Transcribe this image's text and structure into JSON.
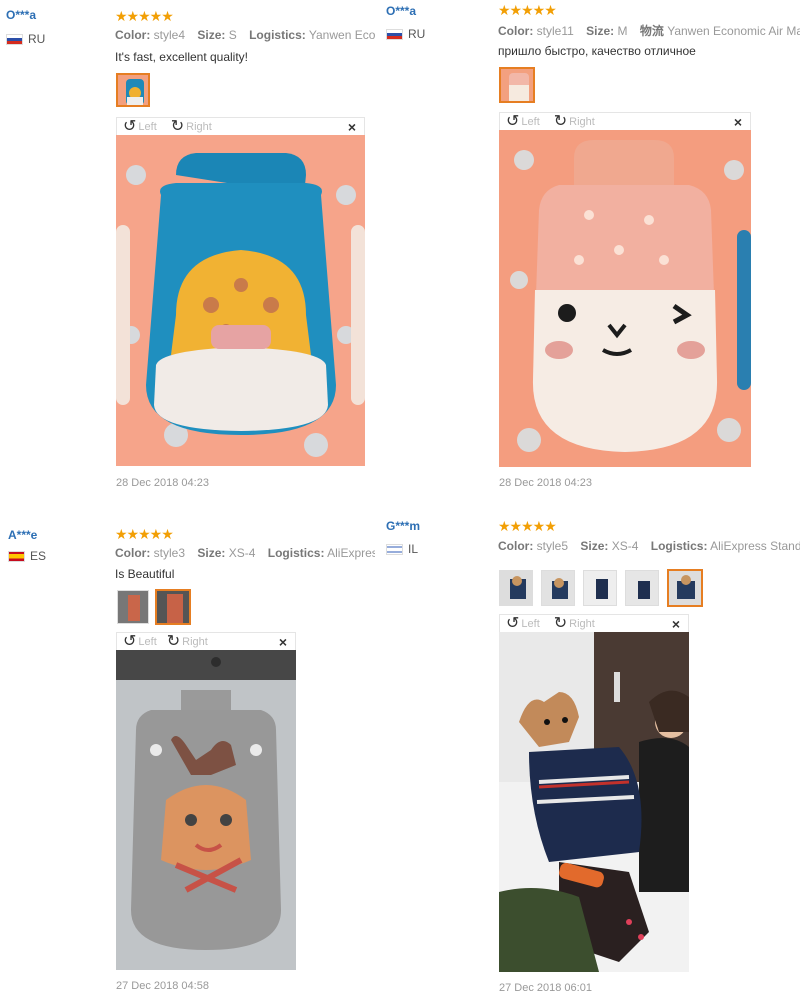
{
  "reviews": [
    {
      "user": "O***a",
      "country": "RU",
      "flag": "ru",
      "stars": "★★★★★",
      "color_label": "Color:",
      "color": "style4",
      "size_label": "Size:",
      "size": "S",
      "logistics_label": "Logistics:",
      "logistics": "Yanwen Economic Air Mail",
      "comment": "It's fast, excellent quality!",
      "left_label": "Left",
      "right_label": "Right",
      "date": "28 Dec 2018 04:23"
    },
    {
      "user": "O***a",
      "country": "RU",
      "flag": "ru",
      "stars": "★★★★★",
      "color_label": "Color:",
      "color": "style11",
      "size_label": "Size:",
      "size": "M",
      "logistics_label": "物流",
      "logistics": "Yanwen Economic Air Mail",
      "comment": "пришло быстро, качество отличное",
      "left_label": "Left",
      "right_label": "Right",
      "date": "28 Dec 2018 04:23"
    },
    {
      "user": "A***e",
      "country": "ES",
      "flag": "es",
      "stars": "★★★★★",
      "color_label": "Color:",
      "color": "style3",
      "size_label": "Size:",
      "size": "XS-4",
      "logistics_label": "Logistics:",
      "logistics": "AliExpress Saver Shipping",
      "comment": "Is Beautiful",
      "left_label": "Left",
      "right_label": "Right",
      "date": "27 Dec 2018 04:58"
    },
    {
      "user": "G***m",
      "country": "IL",
      "flag": "il",
      "stars": "★★★★★",
      "color_label": "Color:",
      "color": "style5",
      "size_label": "Size:",
      "size": "XS-4",
      "logistics_label": "Logistics:",
      "logistics": "AliExpress Standard Shipping",
      "comment": "",
      "left_label": "Left",
      "right_label": "Right",
      "date": "27 Dec 2018 06:01"
    }
  ],
  "close_glyph": "×",
  "rotate_left_glyph": "↺",
  "rotate_right_glyph": "↻",
  "colors": {
    "accent": "#e67e22",
    "stars": "#f29f05",
    "username": "#2d6fb4"
  }
}
